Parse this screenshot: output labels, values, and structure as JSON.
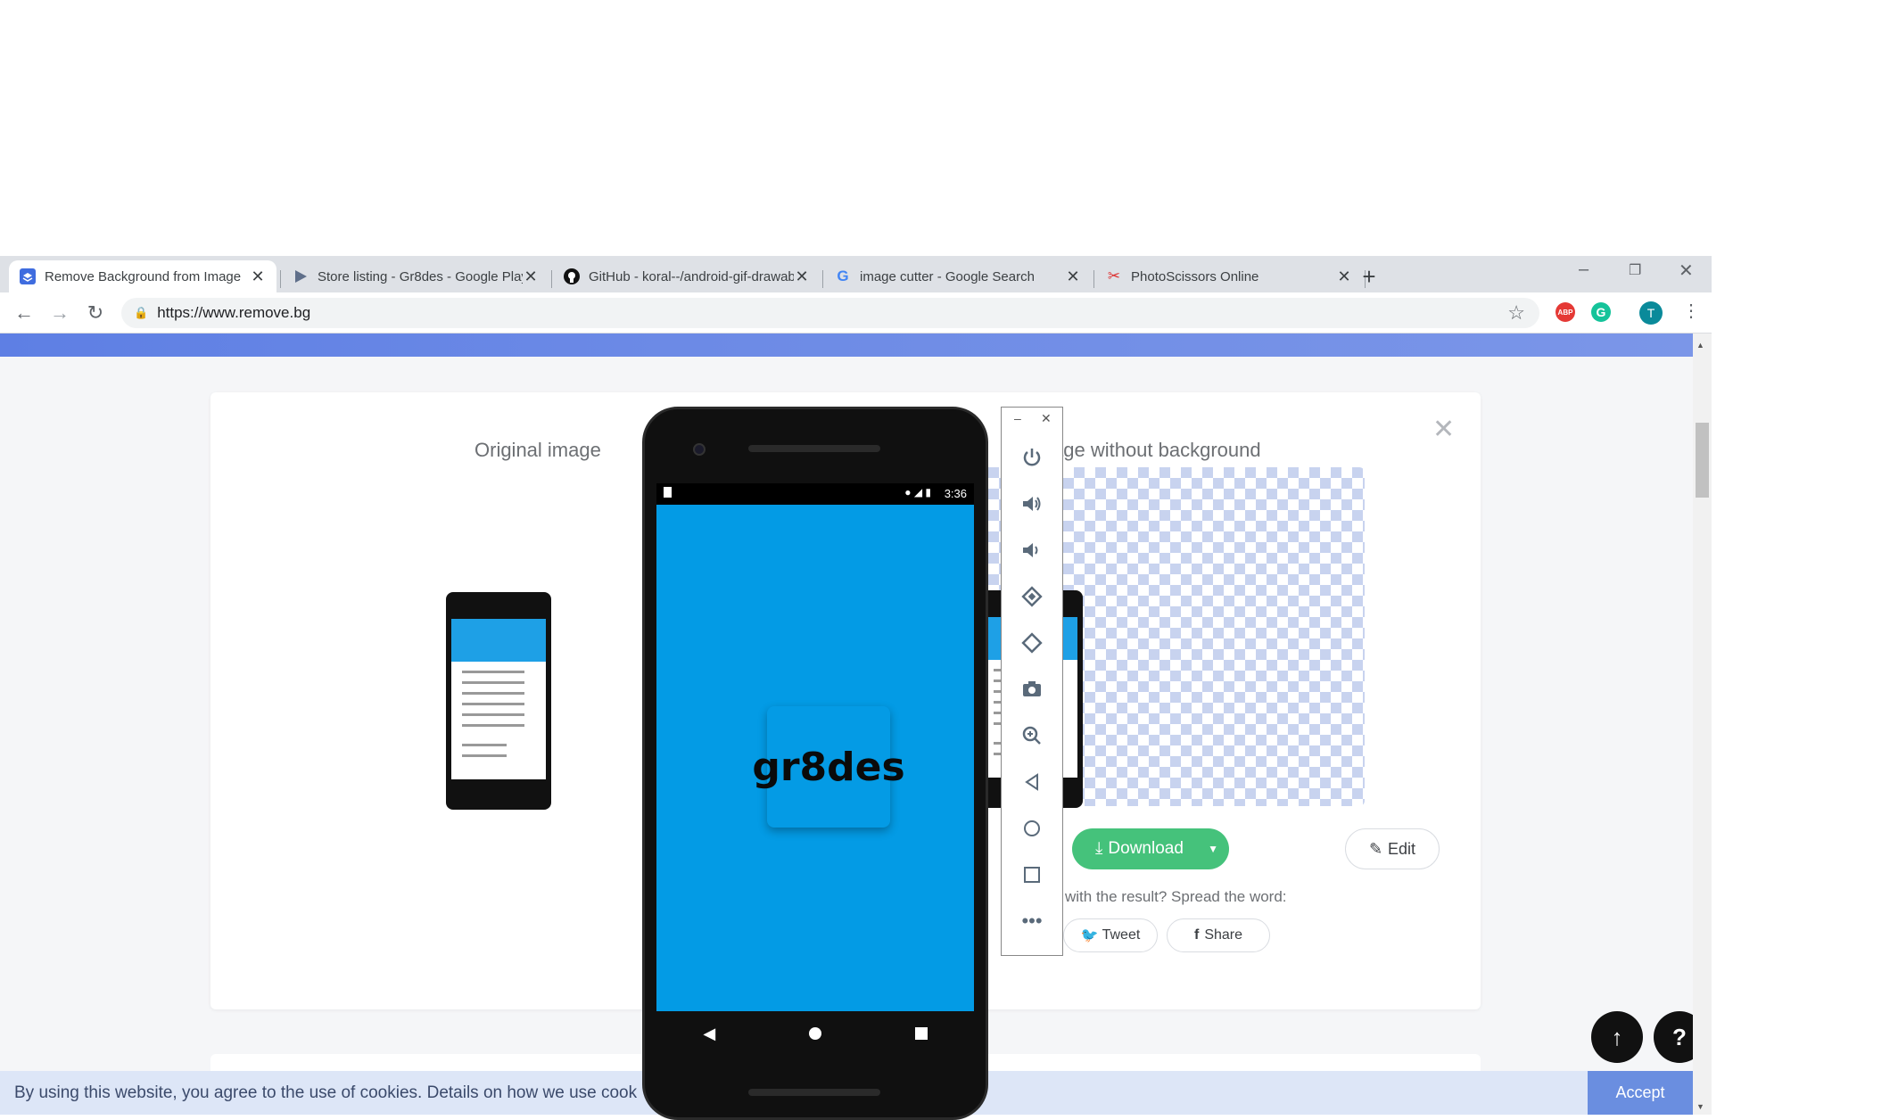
{
  "tabs": [
    {
      "title": "Remove Background from Image",
      "active": true,
      "icon": "remove-bg-favicon"
    },
    {
      "title": "Store listing - Gr8des - Google Play",
      "icon": "google-play-favicon"
    },
    {
      "title": "GitHub - koral--/android-gif-drawable",
      "icon": "github-favicon"
    },
    {
      "title": "image cutter - Google Search",
      "icon": "google-favicon"
    },
    {
      "title": "PhotoScissors Online",
      "icon": "photoscissors-favicon"
    }
  ],
  "browser": {
    "url": "https://www.remove.bg",
    "profile_initial": "T",
    "abp_label": "ABP"
  },
  "page": {
    "original_label": "Original image",
    "result_label": "age without background",
    "download_label": "Download",
    "edit_label": "Edit",
    "spread_text": "with the result? Spread the word:",
    "tweet_label": "Tweet",
    "share_label": "Share",
    "cookie_text": "By using this website, you agree to the use of cookies. Details on how we use cook",
    "accept_label": "Accept",
    "scroll_top_label": "↑",
    "help_label": "?"
  },
  "emulator": {
    "clock": "3:36",
    "app_name": "gr8des",
    "colors": {
      "screen": "#039be5",
      "accent": "#45c27b"
    }
  }
}
